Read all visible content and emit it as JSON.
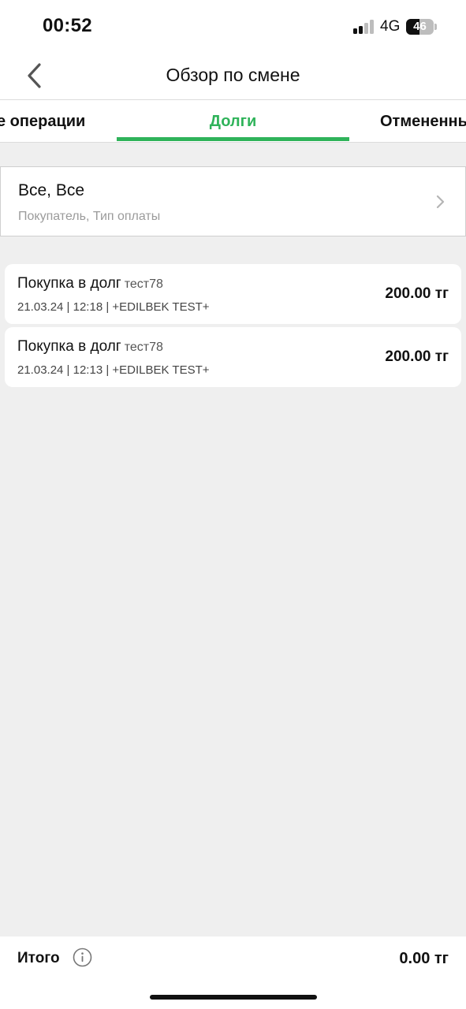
{
  "status_bar": {
    "time": "00:52",
    "network": "4G",
    "battery_level": "46"
  },
  "header": {
    "title": "Обзор по смене"
  },
  "tabs": [
    {
      "label": "е операции",
      "active": false
    },
    {
      "label": "Долги",
      "active": true
    },
    {
      "label": "Отмененны",
      "active": false
    }
  ],
  "filter": {
    "title": "Все, Все",
    "subtitle": "Покупатель, Тип оплаты"
  },
  "transactions": [
    {
      "title": "Покупка в долг",
      "tag": "тест78",
      "meta": "21.03.24 | 12:18 | +EDILBEK TEST+",
      "amount": "200.00 тг"
    },
    {
      "title": "Покупка в долг",
      "tag": "тест78",
      "meta": "21.03.24 | 12:13 | +EDILBEK TEST+",
      "amount": "200.00 тг"
    }
  ],
  "footer": {
    "total_label": "Итого",
    "total_value": "0.00 тг"
  },
  "colors": {
    "accent": "#2fb35a",
    "background": "#efefef",
    "card": "#ffffff",
    "muted_text": "#9b9b9b"
  },
  "icons": [
    "back-chevron-icon",
    "chevron-right-icon",
    "info-icon",
    "signal-icon",
    "battery-icon"
  ]
}
